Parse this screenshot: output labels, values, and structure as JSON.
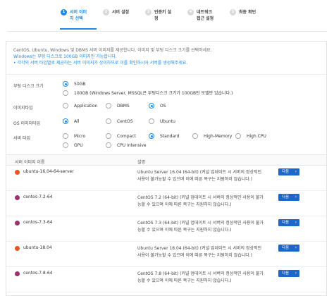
{
  "wizard": {
    "steps": [
      {
        "num": "1",
        "label": "서버 이미\n지 선택"
      },
      {
        "num": "2",
        "label": "서버 설정"
      },
      {
        "num": "3",
        "label": "인증키 설\n정"
      },
      {
        "num": "4",
        "label": "네트워크\n접근 설정"
      },
      {
        "num": "5",
        "label": "최종 확인"
      }
    ]
  },
  "info": {
    "line1": "CentOS, Ubuntu, Windows 및 DBMS 서버 이미지를 제공합니다. 이미지 및 부팅 디스크 크기를 선택하세요.",
    "line2": "Windows는 부팅 디스크로 100GB 이미지만 가능합니다.",
    "line3": "• 각각의 서버 타입별로 제공하는 서버 이미지가 상이하므로 이를 확인하시어 서버를 생성해주세요."
  },
  "form": {
    "boot_disk": {
      "label": "부팅 디스크 크기",
      "options": [
        "50GB",
        "100GB (Windows Server, MSSQL은 부팅디스크 크기가 100GB만 모델만 있습니다.)"
      ]
    },
    "image_type": {
      "label": "이미지타입",
      "options": [
        "Application",
        "DBMS",
        "OS"
      ]
    },
    "os_image_type": {
      "label": "OS 이미지타입",
      "options": [
        "All",
        "CentOS",
        "Ubuntu"
      ]
    },
    "server_type": {
      "label": "서버 타입",
      "options": [
        "Micro",
        "Compact",
        "Standard",
        "High-Memory",
        "High CPU",
        "GPU",
        "CPU Intensive"
      ]
    }
  },
  "table": {
    "col_name": "서버 이미지 이름",
    "col_desc": "설명",
    "rows": [
      {
        "name": "ubuntu-16.04-64-server",
        "desc": "Ubuntu Server 16.04 (64-bit) (커널 업데이트 시 서버의 정상적인 사용이 불가능할 수 있으며 이에 따른 복구는 지원하지 않습니다.)",
        "os": "ubuntu",
        "button": "다음"
      },
      {
        "name": "centos-7.2-64",
        "desc": "CentOS 7.2 (64-bit) (커널 업데이트 시 서버의 정상적인 사용이 불가능할 수 있으며 이에 따른 복구는 지원하지 않습니다.)",
        "os": "centos",
        "button": "다음"
      },
      {
        "name": "centos-7.3-64",
        "desc": "CentOS 7.3 (64-bit) (커널 업데이트 시 서버의 정상적인 사용이 불가능할 수 있으며 이에 따른 복구는 지원하지 않습니다.)",
        "os": "centos",
        "button": "다음"
      },
      {
        "name": "ubuntu-18.04",
        "desc": "Ubuntu Server 18.04 (64-bit) (커널 업데이트 시 서버의 정상적인 사용이 불가능할 수 있으며 이에 따른 복구는 지원하지 않습니다.)",
        "os": "ubuntu",
        "button": "다음"
      },
      {
        "name": "centos-7.8-64",
        "desc": "CentOS 7.8 (64-bit) (커널 업데이트 시 서버의 정상적인 사용이 불가능할 수 있으며 이에 따른 복구는 지원하지 않습니다.)",
        "os": "centos",
        "button": "다음"
      }
    ]
  },
  "colors": {
    "accent": "#1e88e5",
    "button": "#1e66c8",
    "ubuntu": "#e95420",
    "centos": "#a0306e"
  },
  "icons": {
    "ubuntu": "ubuntu-logo-icon",
    "centos": "centos-logo-icon",
    "next": "chevron-right-icon"
  }
}
